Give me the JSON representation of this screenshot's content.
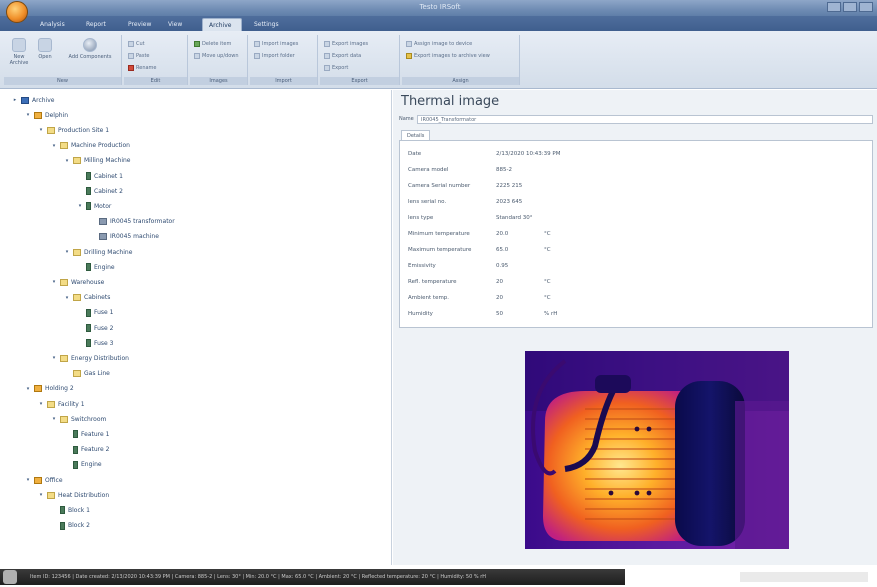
{
  "app": {
    "title": "Testo IRSoft"
  },
  "tabs": [
    "Analysis",
    "Report",
    "Preview",
    "View",
    "Archive",
    "Settings"
  ],
  "active_tab": 4,
  "ribbon": {
    "groups": [
      {
        "label": "New",
        "buttons": [
          "New Archive",
          "Open",
          "Add Components"
        ]
      },
      {
        "label": "Edit",
        "buttons": [
          "Cut",
          "Paste",
          "Rename"
        ]
      },
      {
        "label": "Images",
        "buttons": [
          "Delete item",
          "Move up/down"
        ]
      },
      {
        "label": "Import",
        "buttons": [
          "Import images",
          "Import folder"
        ]
      },
      {
        "label": "Export",
        "buttons": [
          "Export images",
          "Export data",
          "Export"
        ]
      },
      {
        "label": "Assign",
        "buttons": [
          "Assign image to device",
          "Export images to archive view"
        ]
      }
    ]
  },
  "tree": [
    {
      "indent": 0,
      "expander": "▸",
      "icon": "building",
      "label": "Archive"
    },
    {
      "indent": 1,
      "expander": "▾",
      "icon": "company",
      "label": "Delphin"
    },
    {
      "indent": 2,
      "expander": "▾",
      "icon": "folder",
      "label": "Production Site 1"
    },
    {
      "indent": 3,
      "expander": "▾",
      "icon": "folder",
      "label": "Machine Production"
    },
    {
      "indent": 4,
      "expander": "▾",
      "icon": "folder",
      "label": "Milling Machine"
    },
    {
      "indent": 5,
      "expander": "",
      "icon": "device",
      "label": "Cabinet 1"
    },
    {
      "indent": 5,
      "expander": "",
      "icon": "device",
      "label": "Cabinet 2"
    },
    {
      "indent": 5,
      "expander": "▾",
      "icon": "device",
      "label": "Motor"
    },
    {
      "indent": 6,
      "expander": "",
      "icon": "image",
      "label": "IR0045 transformator"
    },
    {
      "indent": 6,
      "expander": "",
      "icon": "image",
      "label": "IR0045 machine"
    },
    {
      "indent": 4,
      "expander": "▾",
      "icon": "folder",
      "label": "Drilling Machine"
    },
    {
      "indent": 5,
      "expander": "",
      "icon": "device",
      "label": "Engine"
    },
    {
      "indent": 3,
      "expander": "▾",
      "icon": "folder",
      "label": "Warehouse"
    },
    {
      "indent": 4,
      "expander": "▾",
      "icon": "folder",
      "label": "Cabinets"
    },
    {
      "indent": 5,
      "expander": "",
      "icon": "device",
      "label": "Fuse 1"
    },
    {
      "indent": 5,
      "expander": "",
      "icon": "device",
      "label": "Fuse 2"
    },
    {
      "indent": 5,
      "expander": "",
      "icon": "device",
      "label": "Fuse 3"
    },
    {
      "indent": 3,
      "expander": "▾",
      "icon": "folder",
      "label": "Energy Distribution"
    },
    {
      "indent": 4,
      "expander": "",
      "icon": "folder",
      "label": "Gas Line"
    },
    {
      "indent": 1,
      "expander": "▾",
      "icon": "company",
      "label": "Holding 2"
    },
    {
      "indent": 2,
      "expander": "▾",
      "icon": "folder",
      "label": "Facility 1"
    },
    {
      "indent": 3,
      "expander": "▾",
      "icon": "folder",
      "label": "Switchroom"
    },
    {
      "indent": 4,
      "expander": "",
      "icon": "device",
      "label": "Feature 1"
    },
    {
      "indent": 4,
      "expander": "",
      "icon": "device",
      "label": "Feature 2"
    },
    {
      "indent": 4,
      "expander": "",
      "icon": "device",
      "label": "Engine"
    },
    {
      "indent": 1,
      "expander": "▾",
      "icon": "company",
      "label": "Office"
    },
    {
      "indent": 2,
      "expander": "▾",
      "icon": "folder",
      "label": "Heat Distribution"
    },
    {
      "indent": 3,
      "expander": "",
      "icon": "device",
      "label": "Block 1"
    },
    {
      "indent": 3,
      "expander": "",
      "icon": "device",
      "label": "Block 2"
    }
  ],
  "detail": {
    "title": "Thermal image",
    "name_label": "Name",
    "name_value": "IR0045_Transformator",
    "tab_label": "Details",
    "properties": [
      {
        "label": "Date",
        "value": "2/13/2020 10:43:39 PM",
        "unit": ""
      },
      {
        "label": "Camera model",
        "value": "885-2",
        "unit": ""
      },
      {
        "label": "Camera Serial number",
        "value": "2225 215",
        "unit": ""
      },
      {
        "label": "lens serial no.",
        "value": "2023 645",
        "unit": ""
      },
      {
        "label": "lens type",
        "value": "Standard 30°",
        "unit": ""
      },
      {
        "label": "Minimum temperature",
        "value": "20.0",
        "unit": "°C"
      },
      {
        "label": "Maximum temperature",
        "value": "65.0",
        "unit": "°C"
      },
      {
        "label": "Emissivity",
        "value": "0.95",
        "unit": ""
      },
      {
        "label": "Refl. temperature",
        "value": "20",
        "unit": "°C"
      },
      {
        "label": "Ambient temp.",
        "value": "20",
        "unit": "°C"
      },
      {
        "label": "Humidity",
        "value": "50",
        "unit": "% rH"
      }
    ]
  },
  "statusbar": {
    "text": "Item ID: 123456 | Date created: 2/13/2020 10:43:39 PM | Camera: 885-2 | Lens: 30° | Min: 20.0 °C | Max: 65.0 °C | Ambient: 20 °C | Reflected temperature: 20 °C | Humidity: 50 % rH"
  },
  "colors": {
    "accent": "#3f5f8e",
    "tree_text": "#2e4a70"
  }
}
